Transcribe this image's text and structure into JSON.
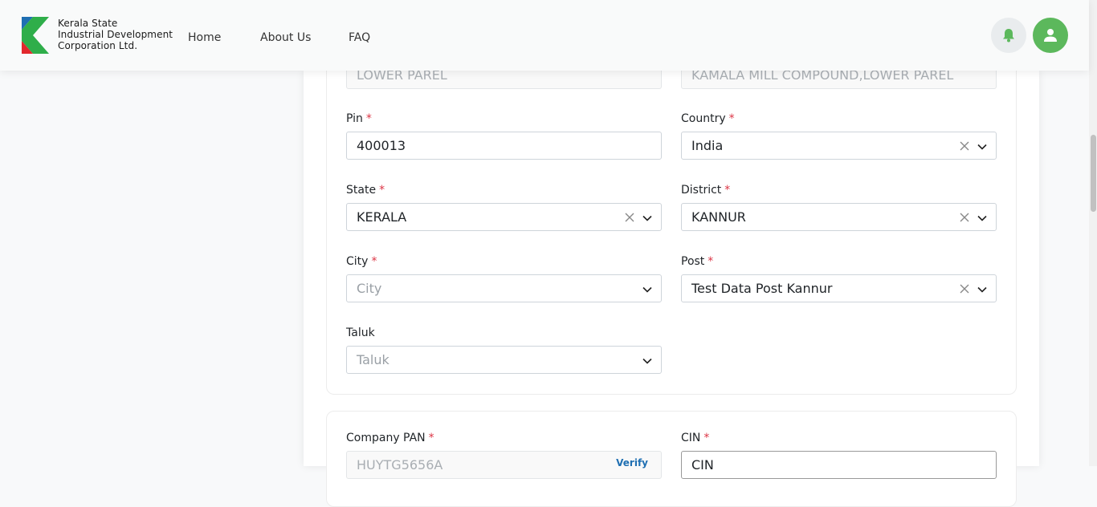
{
  "header": {
    "logo_lines": [
      "Kerala State",
      "Industrial Development",
      "Corporation Ltd."
    ],
    "nav": [
      "Home",
      "About Us",
      "FAQ"
    ]
  },
  "colors": {
    "accent_green": "#5cb85c",
    "required_red": "#dc3545",
    "logo_blue": "#1f6fb2",
    "logo_green": "#2fae4a",
    "logo_red": "#e2282d"
  },
  "icons": {
    "bell": "bell-icon",
    "user": "user-icon",
    "clear": "close-icon",
    "dropdown": "chevron-down-icon"
  },
  "address": {
    "line_left_value": "LOWER PAREL",
    "line_right_value": "KAMALA MILL COMPOUND,LOWER PAREL"
  },
  "pin": {
    "label": "Pin",
    "value": "400013"
  },
  "country": {
    "label": "Country",
    "value": "India"
  },
  "state": {
    "label": "State",
    "value": "KERALA"
  },
  "district": {
    "label": "District",
    "value": "KANNUR"
  },
  "city": {
    "label": "City",
    "placeholder": "City"
  },
  "post": {
    "label": "Post",
    "value": "Test Data Post Kannur"
  },
  "taluk": {
    "label": "Taluk",
    "placeholder": "Taluk"
  },
  "company_pan": {
    "label": "Company PAN",
    "value": "HUYTG5656A",
    "verify_label": "Verify"
  },
  "cin": {
    "label": "CIN",
    "placeholder": "CIN"
  },
  "required_mark": "*"
}
